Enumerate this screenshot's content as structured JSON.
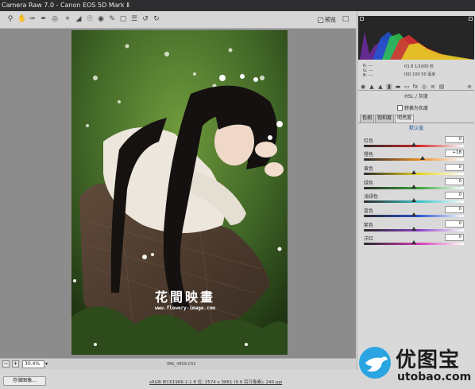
{
  "window": {
    "title": "Camera Raw 7.0 -  Canon EOS 5D Mark Ⅱ"
  },
  "toolbar": {
    "tools": [
      "zoom-tool-icon",
      "hand-tool-icon",
      "white-balance-icon",
      "color-sampler-icon",
      "target-adjust-icon",
      "crop-icon",
      "straighten-icon",
      "spot-removal-icon",
      "red-eye-icon",
      "adjustment-brush-icon",
      "graduated-filter-icon",
      "preferences-icon",
      "rotate-ccw-icon",
      "rotate-cw-icon"
    ],
    "preview_label": "预览",
    "preview_checked": true
  },
  "info": {
    "r_label": "R:",
    "g_label": "G:",
    "b_label": "B:",
    "r_val": "---",
    "g_val": "---",
    "b_val": "---",
    "aperture_shutter": "f/1.8  1/1000 秒",
    "iso_focal": "ISO 100   50 毫米"
  },
  "panel": {
    "title": "HSL / 灰度",
    "grayscale_label": "转换为灰度",
    "subtabs": [
      "色相",
      "饱和度",
      "明亮度"
    ],
    "default_label": "默认值",
    "sliders": [
      {
        "label": "红色",
        "value": "0"
      },
      {
        "label": "橙色",
        "value": "+18"
      },
      {
        "label": "黄色",
        "value": "0"
      },
      {
        "label": "绿色",
        "value": "0"
      },
      {
        "label": "浅绿色",
        "value": "0"
      },
      {
        "label": "蓝色",
        "value": "0"
      },
      {
        "label": "紫色",
        "value": "0"
      },
      {
        "label": "洋红",
        "value": "0"
      }
    ]
  },
  "photo": {
    "title_cn": "花間映畫",
    "site": "www.flowery-image.com"
  },
  "status": {
    "zoom": "30.4%",
    "filename": "IMG_4859.CR2"
  },
  "bottom": {
    "save_label": "存储图像...",
    "workflow_link": "sRGB IEC61966-2.1 8 位; 2574 x 3861 (9.9 百万像素); 240 ppi"
  },
  "watermark": {
    "cn": "优图宝",
    "url": "utobao.com"
  },
  "slider_colors": [
    "#d02525",
    "#e88a20",
    "#e3d21c",
    "#37a43a",
    "#36c2c8",
    "#2a52cf",
    "#8a3fc7",
    "#d23ab8"
  ]
}
